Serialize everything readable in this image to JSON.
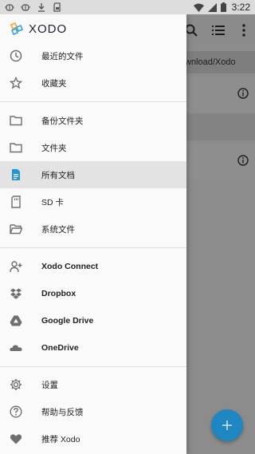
{
  "status": {
    "time": "3:22"
  },
  "brand": {
    "name": "XODO"
  },
  "drawer": {
    "group1": [
      {
        "label": "最近的文件",
        "icon": "clock-icon"
      },
      {
        "label": "收藏夹",
        "icon": "star-icon"
      }
    ],
    "group2": [
      {
        "label": "备份文件夹",
        "icon": "folder-outline-icon"
      },
      {
        "label": "文件夹",
        "icon": "folder-outline-icon"
      },
      {
        "label": "所有文档",
        "icon": "document-icon",
        "active": true
      },
      {
        "label": "SD 卡",
        "icon": "sd-card-icon"
      },
      {
        "label": "系统文件",
        "icon": "folder-open-icon"
      }
    ],
    "group3": [
      {
        "label": "Xodo Connect",
        "icon": "add-person-icon"
      },
      {
        "label": "Dropbox",
        "icon": "dropbox-icon"
      },
      {
        "label": "Google Drive",
        "icon": "google-drive-icon"
      },
      {
        "label": "OneDrive",
        "icon": "onedrive-icon"
      }
    ],
    "group4": [
      {
        "label": "设置",
        "icon": "gear-icon"
      },
      {
        "label": "帮助与反馈",
        "icon": "help-icon"
      },
      {
        "label": "推荐 Xodo",
        "icon": "heart-icon"
      }
    ]
  },
  "background": {
    "path_text": "wnload/Xodo"
  },
  "colors": {
    "accent": "#1e86c0",
    "active_icon": "#2196d3",
    "icon_gray": "#6f6f6f"
  }
}
